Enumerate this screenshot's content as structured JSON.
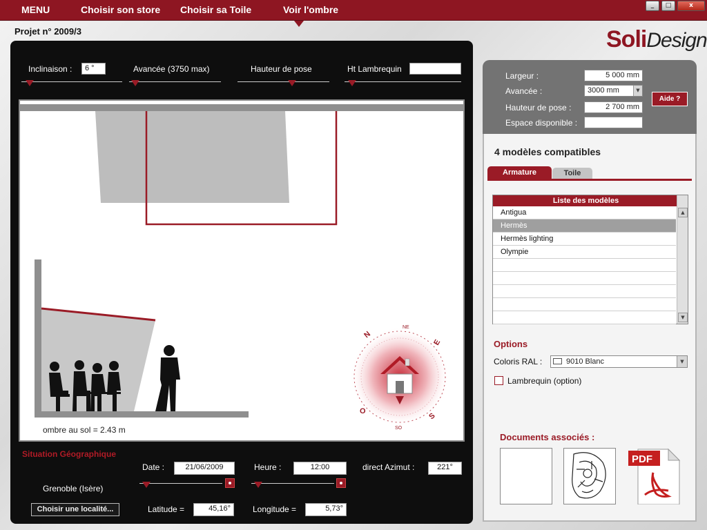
{
  "menu": {
    "items": [
      "MENU",
      "Choisir son store",
      "Choisir sa Toile",
      "Voir l'ombre"
    ],
    "active_index": 3
  },
  "window_controls": {
    "minimize": "_",
    "maximize": "□",
    "close": "x"
  },
  "project": {
    "title": "Projet n° 2009/3"
  },
  "brand": {
    "part1": "Soli",
    "part2": "Design"
  },
  "controls": {
    "inclinaison": {
      "label": "Inclinaison :",
      "value": "6 °"
    },
    "avancee": {
      "label": "Avancée (3750 max)"
    },
    "hauteur": {
      "label": "Hauteur de pose"
    },
    "lambrequin": {
      "label": "Ht Lambrequin",
      "value": ""
    }
  },
  "scene": {
    "shadow_text": "ombre au sol = 2.43 m",
    "compass": {
      "north": "N",
      "east": "E",
      "south": "S",
      "west": "O",
      "northeast": "NE",
      "southwest": "SO"
    }
  },
  "geo": {
    "title": "Situation Géographique",
    "city": "Grenoble (Isère)",
    "choose_button": "Choisir une localité...",
    "date_label": "Date :",
    "date_value": "21/06/2009",
    "heure_label": "Heure :",
    "heure_value": "12:00",
    "azimut_label": "direct Azimut :",
    "azimut_value": "221°",
    "latitude_label": "Latitude =",
    "latitude_value": "45,16°",
    "longitude_label": "Longitude =",
    "longitude_value": "5,73°"
  },
  "dimensions": {
    "largeur_label": "Largeur :",
    "largeur_value": "5 000 mm",
    "avancee_label": "Avancée :",
    "avancee_value": "3000 mm",
    "hauteur_label": "Hauteur de pose :",
    "hauteur_value": "2 700 mm",
    "espace_label": "Espace disponible :",
    "espace_value": "",
    "aide_button": "Aide ?"
  },
  "models": {
    "count_text": "4 modèles compatibles",
    "tabs": [
      "Armature",
      "Toile"
    ],
    "list_header": "Liste des modèles",
    "items": [
      "Antigua",
      "Hermès",
      "Hermès lighting",
      "Olympie",
      "",
      "",
      "",
      "",
      ""
    ],
    "selected_index": 1
  },
  "options": {
    "title": "Options",
    "coloris_label": "Coloris RAL :",
    "coloris_value": "9010 Blanc",
    "lambrequin_label": "Lambrequin (option)",
    "lambrequin_checked": false
  },
  "documents": {
    "title": "Documents associés :",
    "pdf_label": "PDF"
  },
  "colors": {
    "accent": "#9a1b26",
    "topbar": "#8e1622",
    "panel": "#0e0e0e"
  }
}
